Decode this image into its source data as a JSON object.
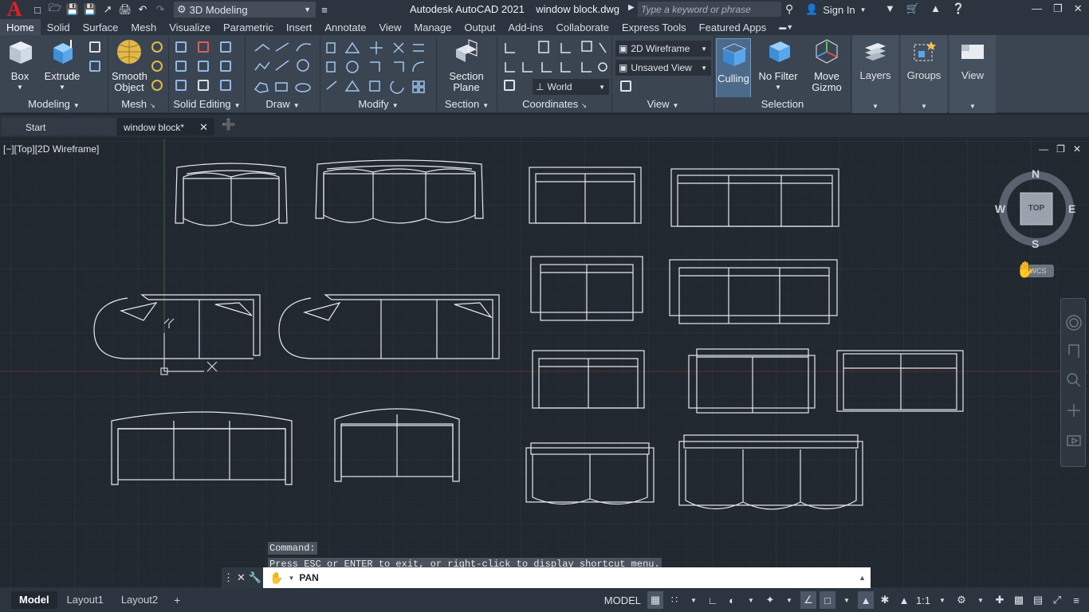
{
  "app": {
    "logo": "A",
    "title": "Autodesk AutoCAD 2021    window block.dwg"
  },
  "quick_access": [
    "new-icon",
    "open-icon",
    "save-icon",
    "save-as-icon",
    "export-icon",
    "print-icon",
    "undo-icon",
    "redo-icon"
  ],
  "workspace": {
    "value": "3D Modeling"
  },
  "search": {
    "placeholder": "Type a keyword or phrase"
  },
  "account": {
    "signin": "Sign In"
  },
  "ribbon_tabs": [
    "Home",
    "Solid",
    "Surface",
    "Mesh",
    "Visualize",
    "Parametric",
    "Insert",
    "Annotate",
    "View",
    "Manage",
    "Output",
    "Add-ins",
    "Collaborate",
    "Express Tools",
    "Featured Apps"
  ],
  "ribbon": {
    "box": "Box",
    "extrude": "Extrude",
    "smooth_object": "Smooth\nObject",
    "section_plane": "Section\nPlane",
    "visual_style": "2D Wireframe",
    "view": "Unsaved View",
    "ucs": "World",
    "culling": "Culling",
    "no_filter": "No Filter",
    "move_gizmo": "Move\nGizmo",
    "layers": "Layers",
    "groups": "Groups",
    "view_panel": "View",
    "panels": {
      "modeling": "Modeling",
      "mesh": "Mesh",
      "solid_editing": "Solid Editing",
      "draw": "Draw",
      "modify": "Modify",
      "section": "Section",
      "coordinates": "Coordinates",
      "view": "View",
      "selection": "Selection"
    }
  },
  "doc_tabs": {
    "start": "Start",
    "doc": "window block*"
  },
  "viewport": {
    "label": "[−][Top][2D Wireframe]"
  },
  "viewcube": {
    "top": "TOP",
    "n": "N",
    "s": "S",
    "e": "E",
    "w": "W",
    "wcs": "WCS"
  },
  "command": {
    "history": [
      "Command:",
      "Press ESC or ENTER to exit, or right-click to display shortcut menu."
    ],
    "current": "PAN"
  },
  "layouts": [
    "Model",
    "Layout1",
    "Layout2"
  ],
  "status": {
    "model": "MODEL",
    "scale": "1:1"
  },
  "colors": {
    "accent": "#4b8fd6",
    "background": "#212830",
    "ribbon": "#3b4552",
    "grid": "#2a3240",
    "x_axis": "#7a2a2a",
    "y_axis": "#2c7a2c"
  }
}
